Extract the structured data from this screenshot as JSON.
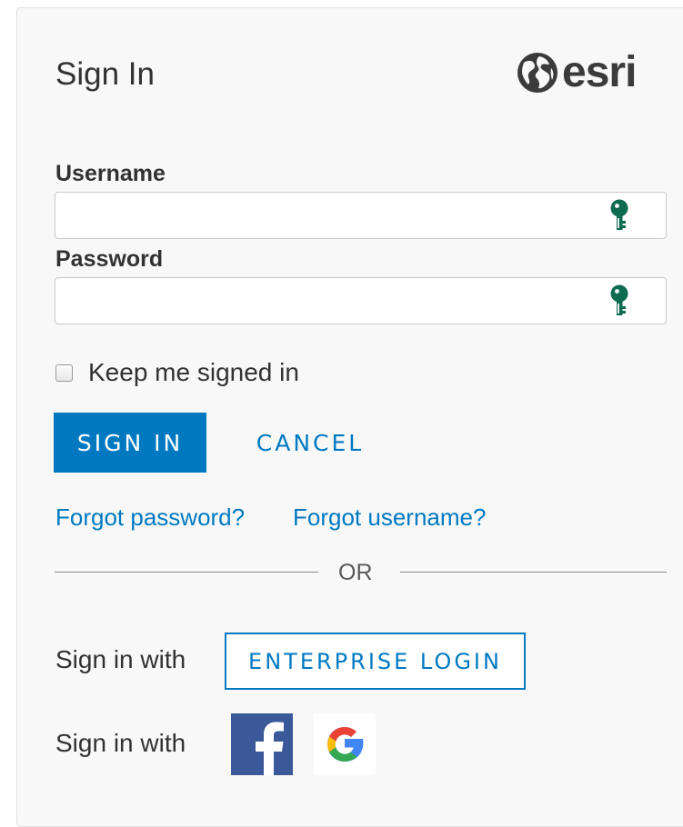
{
  "header": {
    "title": "Sign In",
    "logo_text": "esri",
    "logo_icon": "globe-icon"
  },
  "form": {
    "username_label": "Username",
    "username_value": "",
    "username_placeholder": "",
    "password_label": "Password",
    "password_value": "",
    "password_placeholder": "",
    "field_icon": "key-icon",
    "keep_signed_in_label": "Keep me signed in",
    "keep_signed_in_checked": false,
    "sign_in_label": "SIGN IN",
    "cancel_label": "CANCEL"
  },
  "links": {
    "forgot_password": "Forgot password?",
    "forgot_username": "Forgot username?"
  },
  "divider": {
    "text": "OR"
  },
  "alternate": {
    "sign_in_with_1": "Sign in with",
    "enterprise_label": "ENTERPRISE LOGIN",
    "sign_in_with_2": "Sign in with",
    "social": [
      {
        "name": "facebook",
        "icon": "facebook-icon"
      },
      {
        "name": "google",
        "icon": "google-icon"
      }
    ]
  },
  "colors": {
    "accent": "#0079c1",
    "key_icon": "#0f6b4f",
    "facebook": "#3b5998",
    "text": "#323232",
    "panel_bg": "#f8f8f8"
  }
}
